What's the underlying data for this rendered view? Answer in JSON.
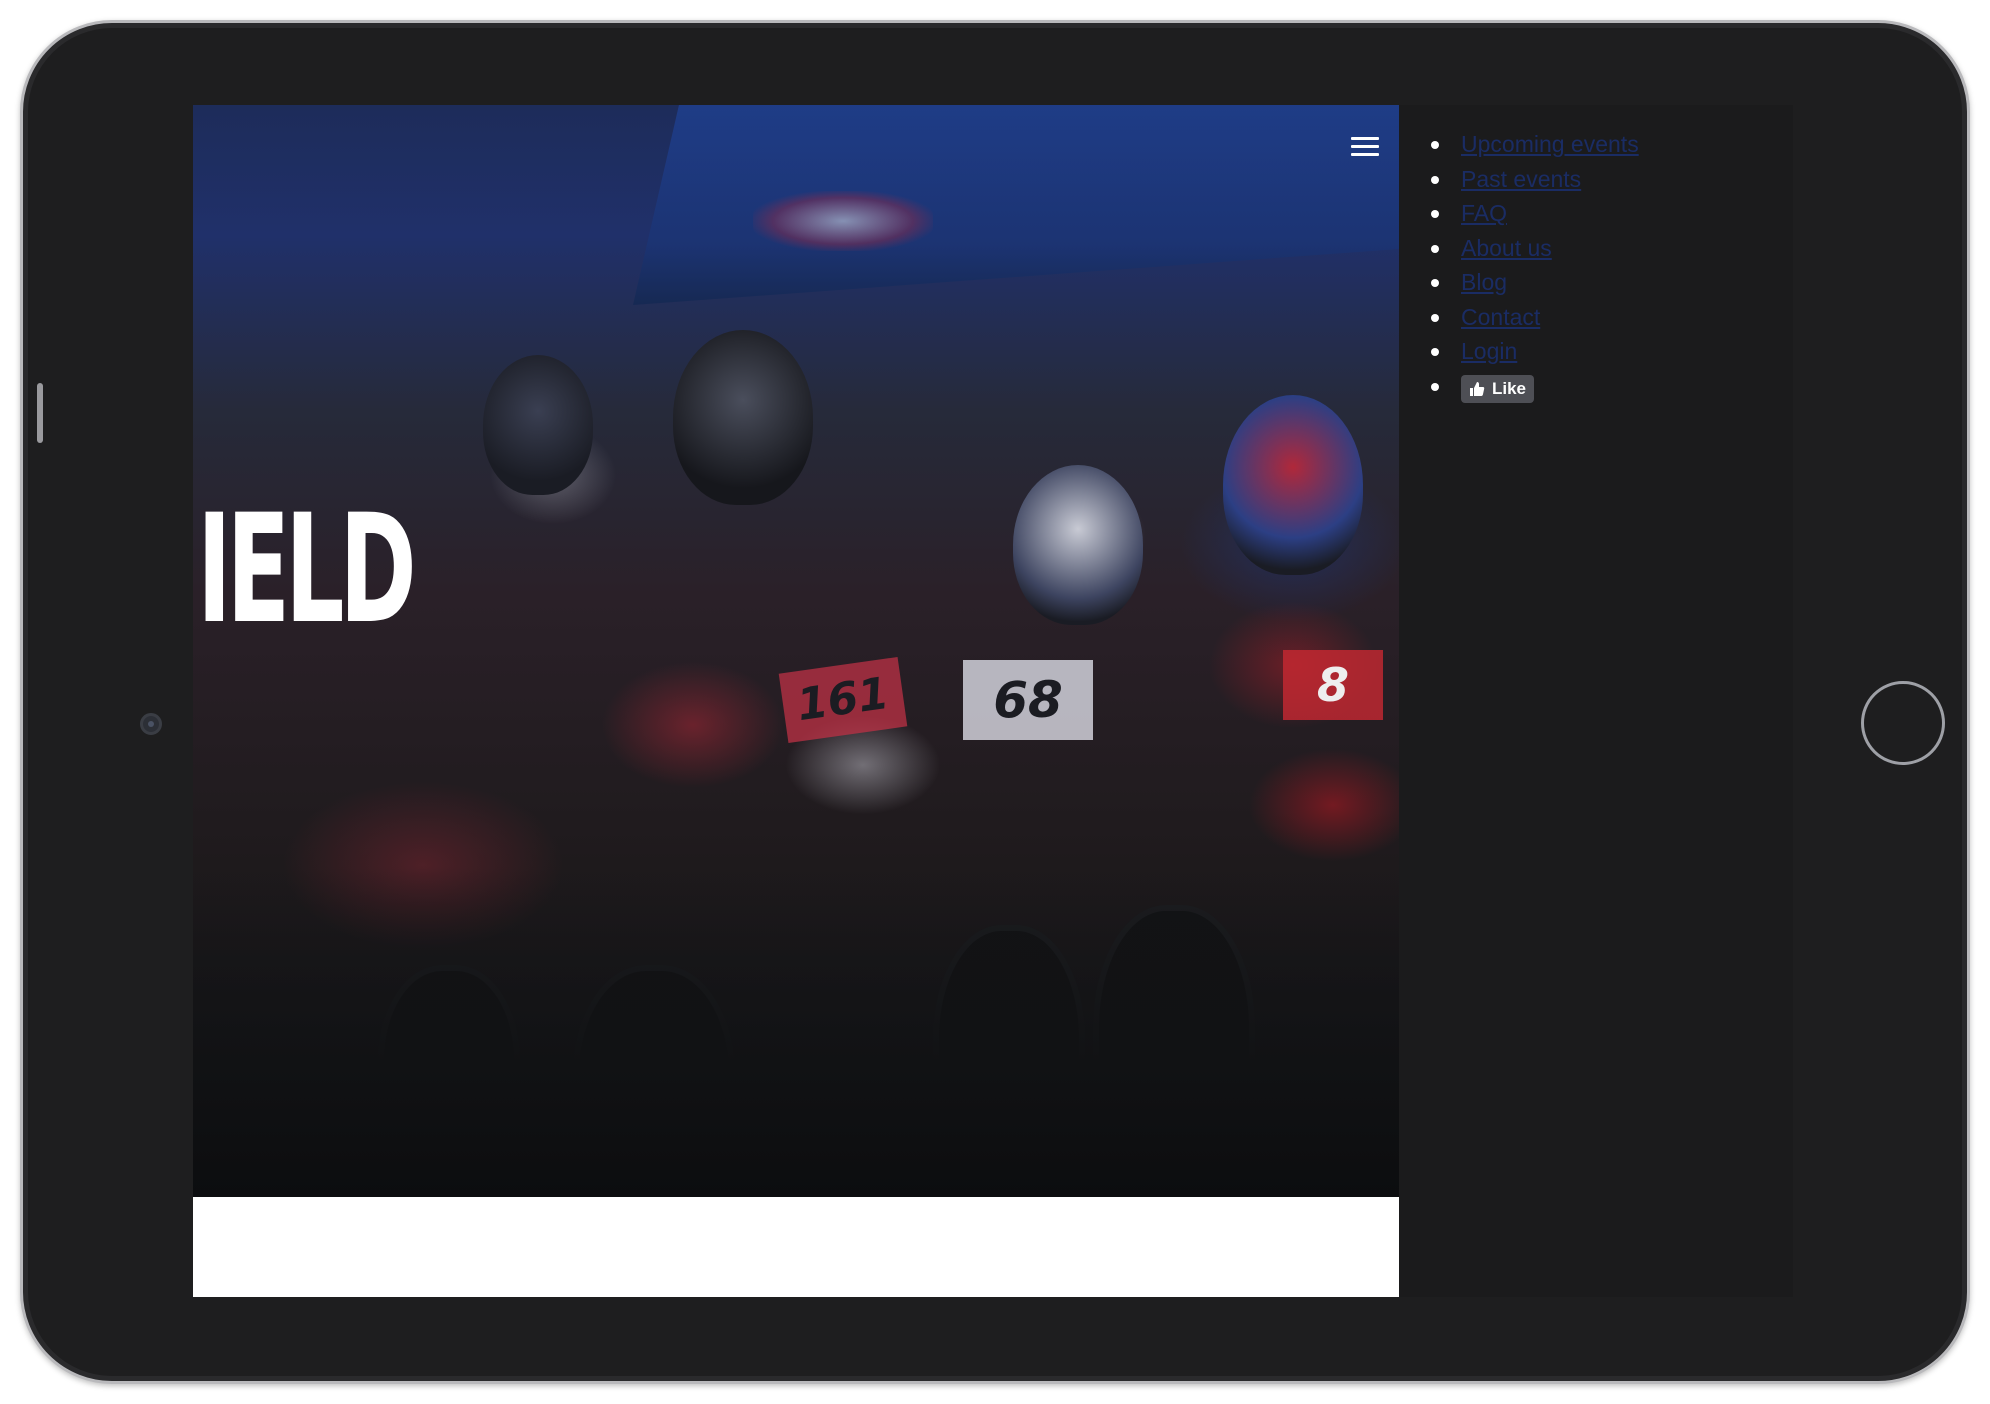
{
  "hero": {
    "title": "IELD",
    "menu_icon": "hamburger-icon",
    "plates": [
      "161",
      "68",
      "8"
    ]
  },
  "nav": {
    "items": [
      {
        "label": "Upcoming events"
      },
      {
        "label": "Past events"
      },
      {
        "label": "FAQ"
      },
      {
        "label": "About us"
      },
      {
        "label": "Blog"
      },
      {
        "label": "Contact"
      },
      {
        "label": "Login"
      }
    ],
    "like": {
      "label": "Like",
      "icon": "thumbs-up-icon"
    }
  },
  "colors": {
    "link": "#1a2c64",
    "screen_bg": "#1b1b1c",
    "frame": "#1e1e1f"
  }
}
